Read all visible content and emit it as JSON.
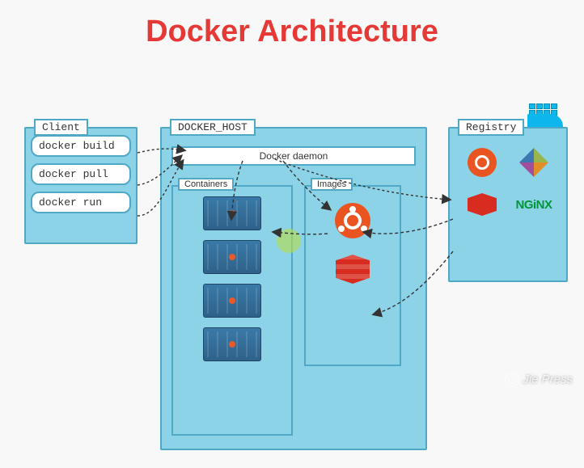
{
  "title": "Docker Architecture",
  "client": {
    "label": "Client",
    "commands": [
      "docker build",
      "docker pull",
      "docker run"
    ]
  },
  "host": {
    "label": "DOCKER_HOST",
    "daemon": "Docker daemon",
    "containers_label": "Containers",
    "images_label": "Images"
  },
  "registry": {
    "label": "Registry",
    "nginx": "NGiNX"
  },
  "watermark": "Jie Press"
}
